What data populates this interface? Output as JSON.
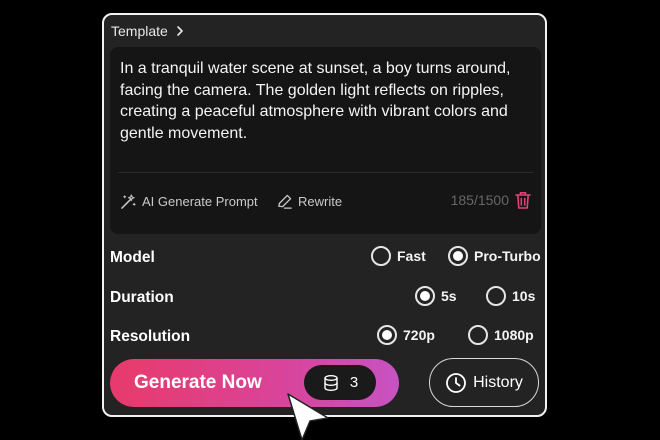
{
  "template": {
    "label": "Template"
  },
  "prompt": {
    "text": "In a tranquil water scene at sunset, a boy turns around, facing the camera. The golden light reflects on ripples, creating a peaceful atmosphere with vibrant colors and gentle movement.",
    "ai_generate_label": "AI Generate Prompt",
    "rewrite_label": "Rewrite",
    "char_count": "185/1500"
  },
  "options": {
    "model": {
      "label": "Model",
      "choices": [
        "Fast",
        "Pro-Turbo"
      ],
      "selected": "Pro-Turbo"
    },
    "duration": {
      "label": "Duration",
      "choices": [
        "5s",
        "10s"
      ],
      "selected": "5s"
    },
    "resolution": {
      "label": "Resolution",
      "choices": [
        "720p",
        "1080p"
      ],
      "selected": "720p"
    }
  },
  "actions": {
    "generate_label": "Generate Now",
    "credits": "3",
    "history_label": "History"
  },
  "colors": {
    "gradient_start": "#e83a6a",
    "gradient_end": "#c653c3",
    "panel_bg": "#232323",
    "prompt_bg": "#151515"
  },
  "icons": [
    "chevron-right-icon",
    "magic-wand-icon",
    "pen-icon",
    "trash-icon",
    "database-icon",
    "clock-icon",
    "mouse-cursor-icon"
  ]
}
